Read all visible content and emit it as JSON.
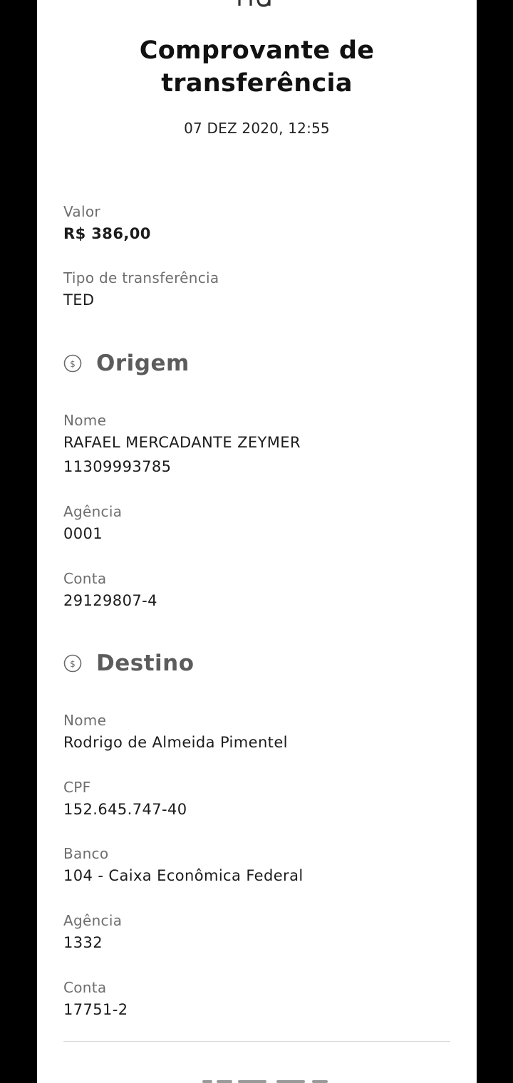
{
  "receipt": {
    "title_line1": "Comprovante de",
    "title_line2": "transferência",
    "datetime": "07 DEZ 2020, 12:55"
  },
  "summary": {
    "amount_label": "Valor",
    "amount_value": "R$ 386,00",
    "type_label": "Tipo de transferência",
    "type_value": "TED"
  },
  "origin": {
    "heading": "Origem",
    "icon": "dollar-circle-icon",
    "name_label": "Nome",
    "name_value": "RAFAEL MERCADANTE ZEYMER",
    "document_value": "11309993785",
    "agency_label": "Agência",
    "agency_value": "0001",
    "account_label": "Conta",
    "account_value": "29129807-4"
  },
  "destination": {
    "heading": "Destino",
    "icon": "dollar-circle-icon",
    "name_label": "Nome",
    "name_value": "Rodrigo de Almeida Pimentel",
    "cpf_label": "CPF",
    "cpf_value": "152.645.747-40",
    "bank_label": "Banco",
    "bank_value": "104 - Caixa Econômica Federal",
    "agency_label": "Agência",
    "agency_value": "1332",
    "account_label": "Conta",
    "account_value": "17751-2"
  },
  "colors": {
    "background": "#000000",
    "card": "#ffffff",
    "label_text": "#6e6e6e",
    "value_text": "#1c1c1c",
    "heading_text": "#5c5c5c",
    "divider": "#d4d4d4"
  }
}
